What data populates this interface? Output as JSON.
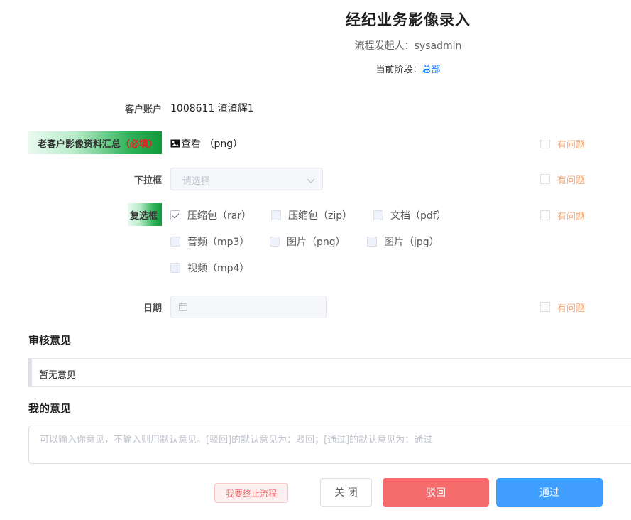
{
  "header": {
    "title": "经纪业务影像录入",
    "initiator_label": "流程发起人：",
    "initiator_value": "sysadmin",
    "stage_label": "当前阶段：",
    "stage_value": "总部"
  },
  "form": {
    "account": {
      "label": "客户账户",
      "value": "1008611 渣渣辉1"
    },
    "image_summary": {
      "label": "老客户影像资料汇总",
      "required": "（必填）",
      "view_text": "查看 （png）",
      "issue": "有问题"
    },
    "dropdown": {
      "label": "下拉框",
      "placeholder": "请选择",
      "issue": "有问题"
    },
    "checkboxes": {
      "label": "复选框",
      "issue": "有问题",
      "options": [
        {
          "label": "压缩包（rar）",
          "checked": true
        },
        {
          "label": "压缩包（zip）",
          "checked": false
        },
        {
          "label": "文档（pdf）",
          "checked": false
        },
        {
          "label": "音频（mp3）",
          "checked": false
        },
        {
          "label": "图片（png）",
          "checked": false
        },
        {
          "label": "图片（jpg）",
          "checked": false
        },
        {
          "label": "视频（mp4）",
          "checked": false
        }
      ]
    },
    "date": {
      "label": "日期",
      "issue": "有问题"
    }
  },
  "review": {
    "title": "审核意见",
    "content": "暂无意见"
  },
  "my_opinion": {
    "title": "我的意见",
    "placeholder": "可以输入你意见，不输入则用默认意见。[驳回]的默认意见为：驳回；[通过]的默认意见为：通过"
  },
  "actions": {
    "stop": "我要终止流程",
    "close": "关 闭",
    "reject": "驳回",
    "pass": "通过"
  }
}
